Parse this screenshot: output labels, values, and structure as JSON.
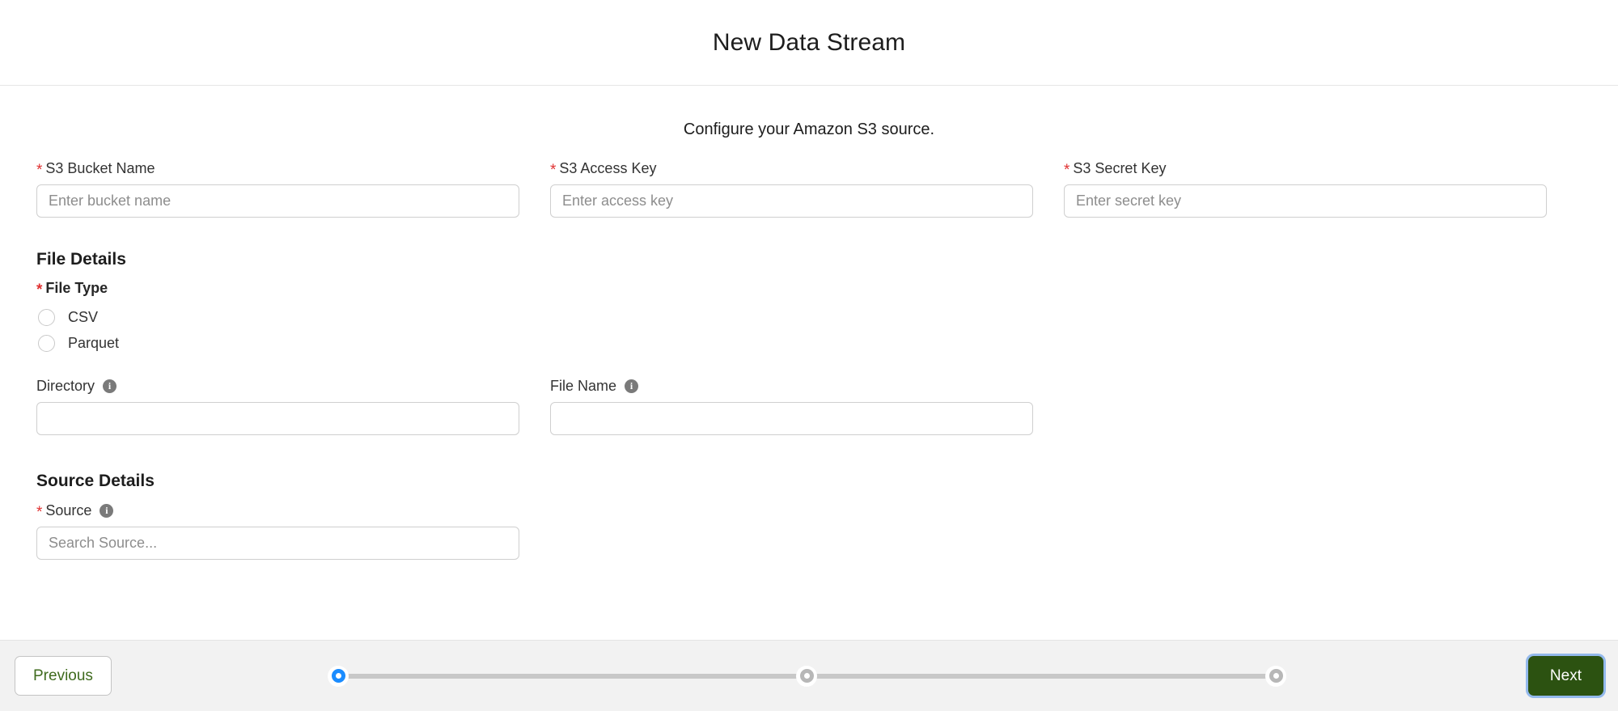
{
  "header": {
    "title": "New Data Stream"
  },
  "body": {
    "subtitle": "Configure your Amazon S3 source.",
    "credentials": [
      {
        "label": "S3 Bucket Name",
        "required": true,
        "placeholder": "Enter bucket name",
        "value": ""
      },
      {
        "label": "S3 Access Key",
        "required": true,
        "placeholder": "Enter access key",
        "value": ""
      },
      {
        "label": "S3 Secret Key",
        "required": true,
        "placeholder": "Enter secret key",
        "value": ""
      }
    ],
    "file_details": {
      "section_title": "File Details",
      "file_type": {
        "label": "File Type",
        "required": true,
        "selected": null,
        "options": [
          {
            "label": "CSV",
            "selected": false
          },
          {
            "label": "Parquet",
            "selected": false
          }
        ]
      },
      "directory": {
        "label": "Directory",
        "required": false,
        "info_icon": "info-icon",
        "placeholder": "",
        "value": ""
      },
      "file_name": {
        "label": "File Name",
        "required": false,
        "info_icon": "info-icon",
        "placeholder": "",
        "value": ""
      }
    },
    "source_details": {
      "section_title": "Source Details",
      "source": {
        "label": "Source",
        "required": true,
        "info_icon": "info-icon",
        "placeholder": "Search Source...",
        "value": ""
      }
    }
  },
  "footer": {
    "previous_label": "Previous",
    "next_label": "Next",
    "stepper": {
      "total_steps": 3,
      "current_step": 1,
      "steps": [
        {
          "index": 1,
          "state": "active"
        },
        {
          "index": 2,
          "state": "inactive"
        },
        {
          "index": 3,
          "state": "inactive"
        }
      ]
    }
  },
  "colors": {
    "accent_green": "#2c5211",
    "prev_text_green": "#3f6b1e",
    "required_red": "#e03030",
    "active_step_blue": "#1a8cff",
    "footer_bg": "#f2f2f2",
    "info_icon_gray": "#7a7a7a"
  }
}
